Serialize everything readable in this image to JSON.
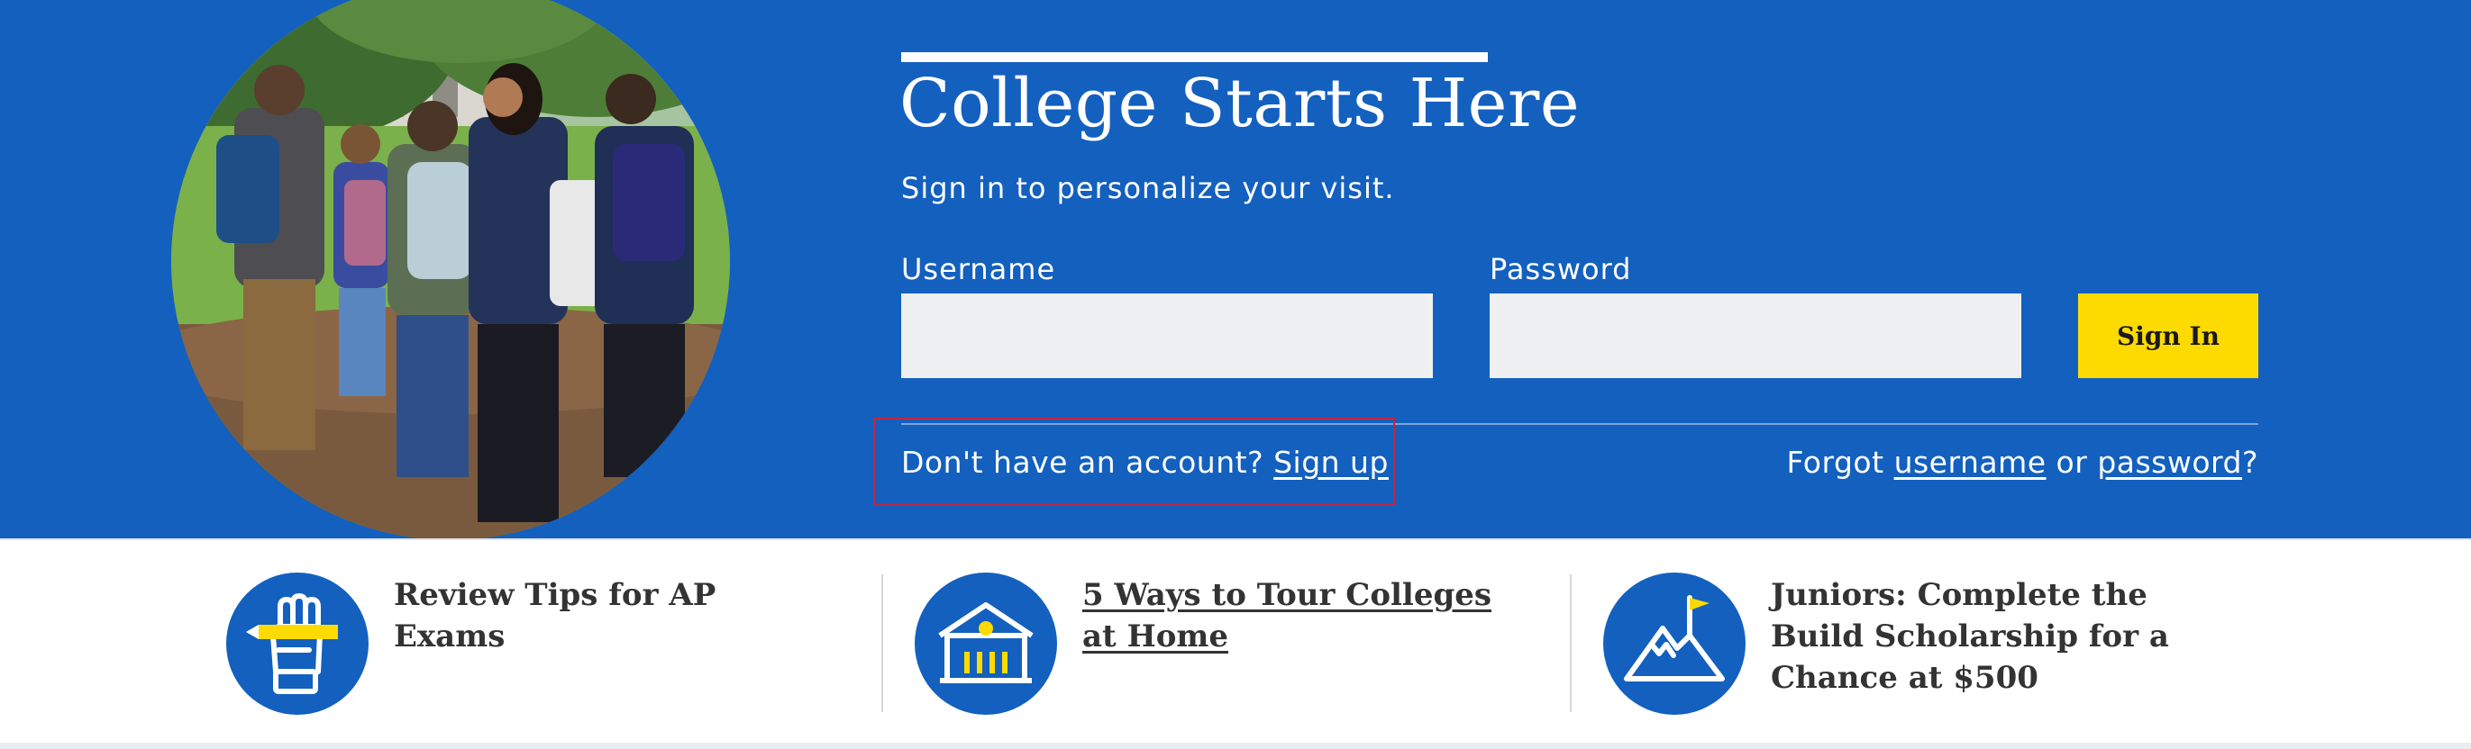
{
  "hero": {
    "title": "College Starts Here",
    "subtitle": "Sign in to personalize your visit.",
    "background_color": "#1360bf",
    "photo": "students-walking-photo"
  },
  "login": {
    "username_label": "Username",
    "username_value": "",
    "password_label": "Password",
    "password_value": "",
    "signin_label": "Sign In",
    "signin_color": "#fedb00"
  },
  "account": {
    "prompt": "Don't have an account?",
    "signup_link": "Sign up"
  },
  "forgot": {
    "prefix": "Forgot",
    "username_link": "username",
    "middle": "or",
    "password_link": "password",
    "suffix": "?"
  },
  "news": [
    {
      "icon": "fist-pencil-icon",
      "title": "Review Tips for AP Exams"
    },
    {
      "icon": "school-building-icon",
      "title": "5 Ways to Tour Colleges at Home"
    },
    {
      "icon": "mountain-flag-icon",
      "title": "Juniors: Complete the Build Scholarship for a Chance at $500"
    }
  ]
}
